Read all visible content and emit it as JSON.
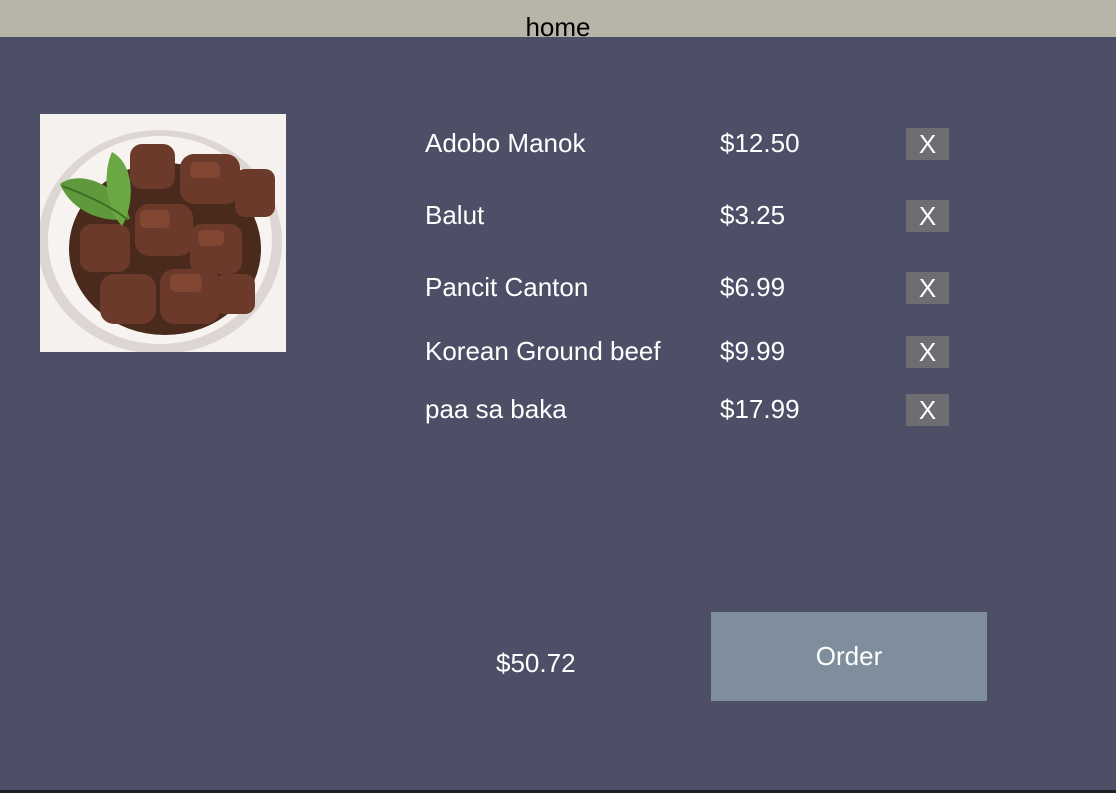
{
  "header": {
    "title": "home"
  },
  "image": {
    "name": "adobo-dish-image"
  },
  "cart": {
    "items": [
      {
        "name": "Adobo Manok",
        "price": "$12.50",
        "remove_label": "X"
      },
      {
        "name": "Balut",
        "price": "$3.25",
        "remove_label": "X"
      },
      {
        "name": "Pancit Canton",
        "price": "$6.99",
        "remove_label": "X"
      },
      {
        "name": "Korean Ground beef",
        "price": "$9.99",
        "remove_label": "X"
      },
      {
        "name": "paa sa baka",
        "price": "$17.99",
        "remove_label": "X"
      }
    ],
    "total": "$50.72",
    "order_label": "Order"
  },
  "colors": {
    "background": "#4d4f66",
    "header": "#b7b5a8",
    "remove_button": "#6e6e72",
    "order_button": "#7e8e9c"
  }
}
